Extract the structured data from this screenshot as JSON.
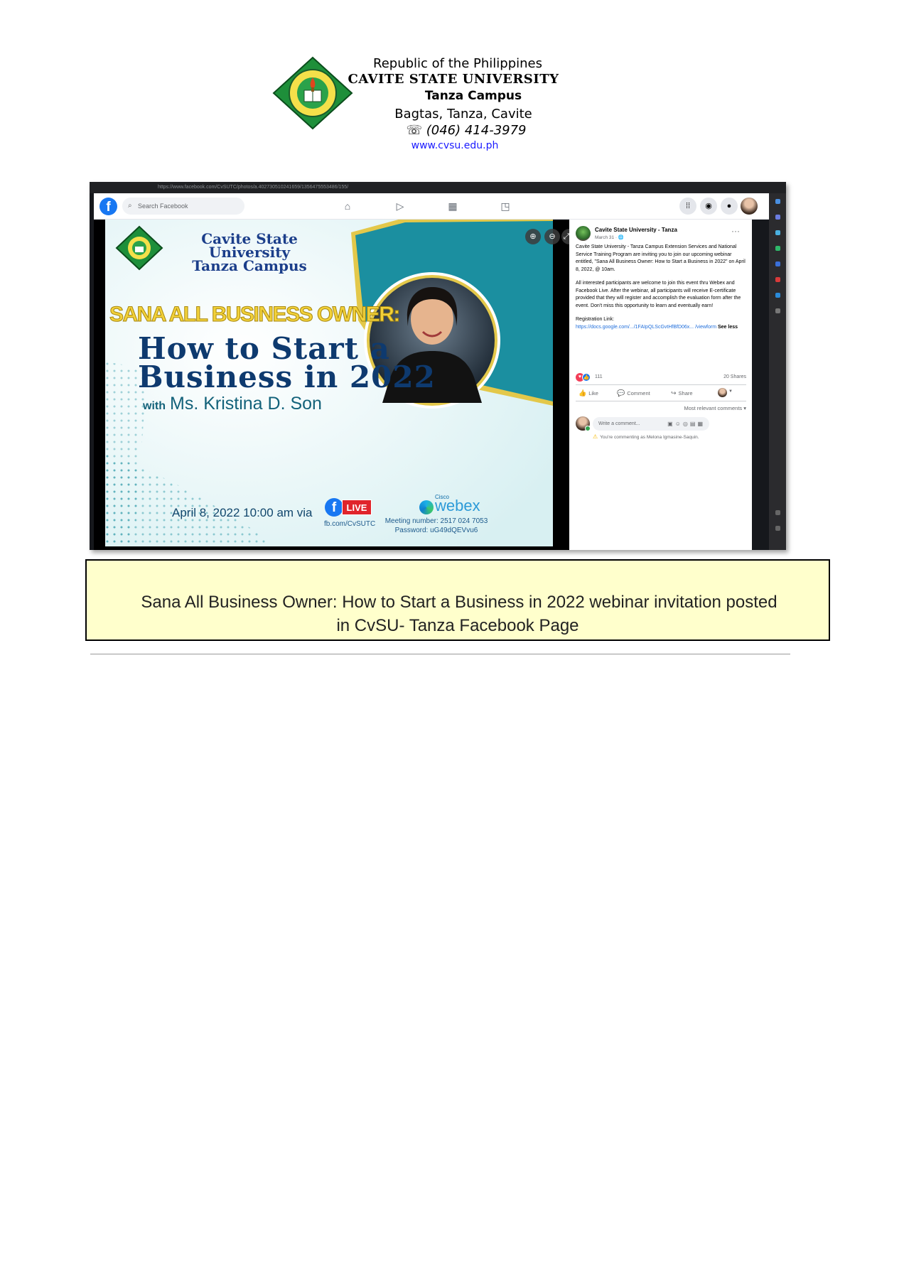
{
  "letterhead": {
    "republic": "Republic of the Philippines",
    "university": "CAVITE STATE UNIVERSITY",
    "campus": "Tanza Campus",
    "address": "Bagtas, Tanza, Cavite",
    "phone": "☏ (046) 414-3979",
    "website": "www.cvsu.edu.ph",
    "seal_icon": "university-seal-icon"
  },
  "browser": {
    "url": "https://www.facebook.com/CvSUTC/photos/a.402730510241659/1356475553486/155/"
  },
  "facebook": {
    "logo_icon": "facebook-logo-icon",
    "search_placeholder": "Search Facebook",
    "nav_icons": [
      "home-icon",
      "watch-icon",
      "marketplace-icon",
      "gaming-icon"
    ],
    "right_icons": [
      "menu-grid-icon",
      "messenger-icon",
      "notifications-icon",
      "profile-avatar-icon"
    ]
  },
  "poster": {
    "univ_line1": "Cavite State University",
    "univ_line2": "Tanza Campus",
    "headline": "SANA ALL BUSINESS OWNER:",
    "title_line1": "How to Start a",
    "title_line2": "Business in 2022",
    "with": "with",
    "speaker": "Ms. Kristina D. Son",
    "date": "April 8, 2022  10:00 am  via",
    "live_label": "LIVE",
    "fb_url": "fb.com/CvSUTC",
    "cisco": "Cisco",
    "webex": "webex",
    "meeting_number": "Meeting number: 2517 024 7053",
    "password": "Password: uG49dQEVvu6",
    "colors": {
      "navy": "#0e3a6f",
      "teal": "#1b8fa0",
      "gold": "#f2d13a"
    }
  },
  "post": {
    "page_name": "Cavite State University - Tanza",
    "date": "March 31 · 🌐",
    "more": "···",
    "para1": "Cavite State University - Tanza Campus Extension Services and National Service Training Program are inviting you to join our upcoming webinar entitled, \"Sana All Business Owner: How to Start a Business in 2022\" on April 8, 2022, @ 10am.",
    "para2": "All interested participants are welcome to join this event thru Webex and Facebook Live. After the webinar, all participants will receive E-certificate provided that they will register and accomplish the evaluation form after the event. Don't miss this opportunity to learn and eventually earn!",
    "reg_label": "Registration Link:",
    "reg_link": "https://docs.google.com/.../1FAIpQLScGvtHfBfD06x... /viewform",
    "see_less": "See less",
    "reactions_count": "111",
    "shares": "20 Shares",
    "like": "Like",
    "comment": "Comment",
    "share": "Share",
    "relevant": "Most relevant comments ▾",
    "comment_placeholder": "Write a comment...",
    "commenting_as": "You're commenting as Melona Igmasine-Saquin."
  },
  "caption": {
    "line1": "Sana All Business Owner: How to Start a Business in 2022 webinar invitation posted",
    "line2": "in CvSU- Tanza Facebook Page"
  }
}
